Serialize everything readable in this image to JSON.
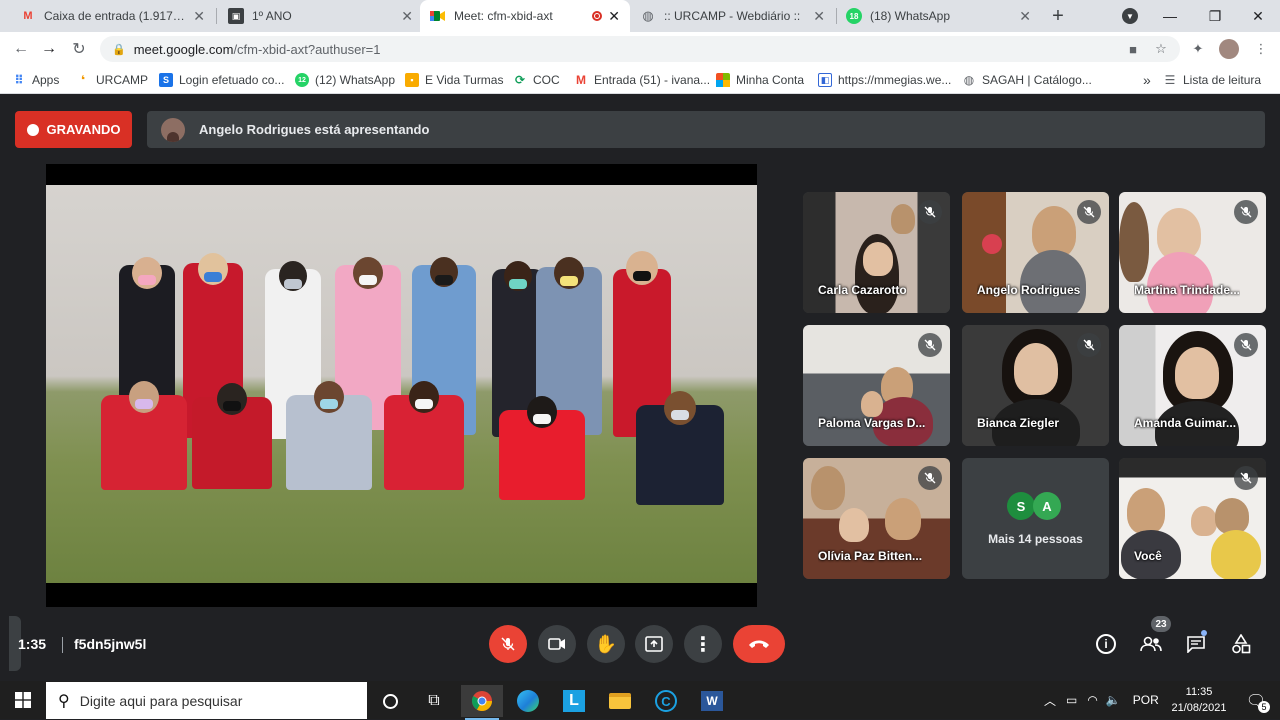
{
  "tabs": [
    {
      "title": "Caixa de entrada (1.917) - iva",
      "favicon": "gmail-icon",
      "color": "#ea4335"
    },
    {
      "title": "1º ANO",
      "favicon": "classroom-icon",
      "color": "#202124"
    },
    {
      "title": "Meet: cfm-xbid-axt",
      "favicon": "meet-icon",
      "color": "#00832d",
      "active": true
    },
    {
      "title": ":: URCAMP - Webdiário ::",
      "favicon": "globe-icon",
      "color": "#5f6368"
    },
    {
      "title": "(18) WhatsApp",
      "favicon": "whatsapp-icon",
      "color": "#25d366",
      "badge": "18"
    }
  ],
  "address": {
    "host": "meet.google.com",
    "path": "/cfm-xbid-axt?authuser=1"
  },
  "bookmarks": [
    {
      "label": "Apps",
      "icon": "apps-grid-icon",
      "color": "#4285f4"
    },
    {
      "label": "URCAMP",
      "icon": "urcamp-icon",
      "color": "#f29900"
    },
    {
      "label": "Login efetuado co...",
      "icon": "s-icon",
      "color": "#1a73e8",
      "glyph": "S"
    },
    {
      "label": "(12) WhatsApp",
      "icon": "whatsapp-icon",
      "color": "#25d366",
      "glyph": "12"
    },
    {
      "label": "E Vida Turmas",
      "icon": "classroom-icon",
      "color": "#f9ab00"
    },
    {
      "label": "COC",
      "icon": "coc-icon",
      "color": "#0f9d58"
    },
    {
      "label": "Entrada (51) - ivana...",
      "icon": "gmail-icon",
      "color": "#ea4335",
      "glyph": "M"
    },
    {
      "label": "Minha Conta",
      "icon": "microsoft-icon",
      "color": "#f25022"
    },
    {
      "label": "https://mmegias.we...",
      "icon": "page-icon",
      "color": "#3367d6"
    },
    {
      "label": "SAGAH | Catálogo...",
      "icon": "globe-icon",
      "color": "#5f6368"
    }
  ],
  "reading_list": "Lista de leitura",
  "recording_label": "GRAVANDO",
  "presenter_text": "Angelo Rodrigues está apresentando",
  "participants": [
    {
      "name": "Carla Cazarotto"
    },
    {
      "name": "Angelo Rodrigues"
    },
    {
      "name": "Martina Trindade..."
    },
    {
      "name": "Paloma Vargas D..."
    },
    {
      "name": "Bianca Ziegler"
    },
    {
      "name": "Amanda Guimar..."
    },
    {
      "name": "Olívia Paz Bitten..."
    },
    {
      "name": "Você"
    }
  ],
  "more_people": {
    "label": "Mais 14 pessoas",
    "avatars": [
      {
        "letter": "S",
        "color": "#1e8e3e"
      },
      {
        "letter": "A",
        "color": "#34a853"
      }
    ]
  },
  "meeting_time": "1:35",
  "meeting_code": "f5dn5jnw5l",
  "people_count": "23",
  "taskbar": {
    "search_placeholder": "Digite aqui para pesquisar",
    "lang": "POR",
    "time": "11:35",
    "date": "21/08/2021",
    "notifications": "5"
  }
}
